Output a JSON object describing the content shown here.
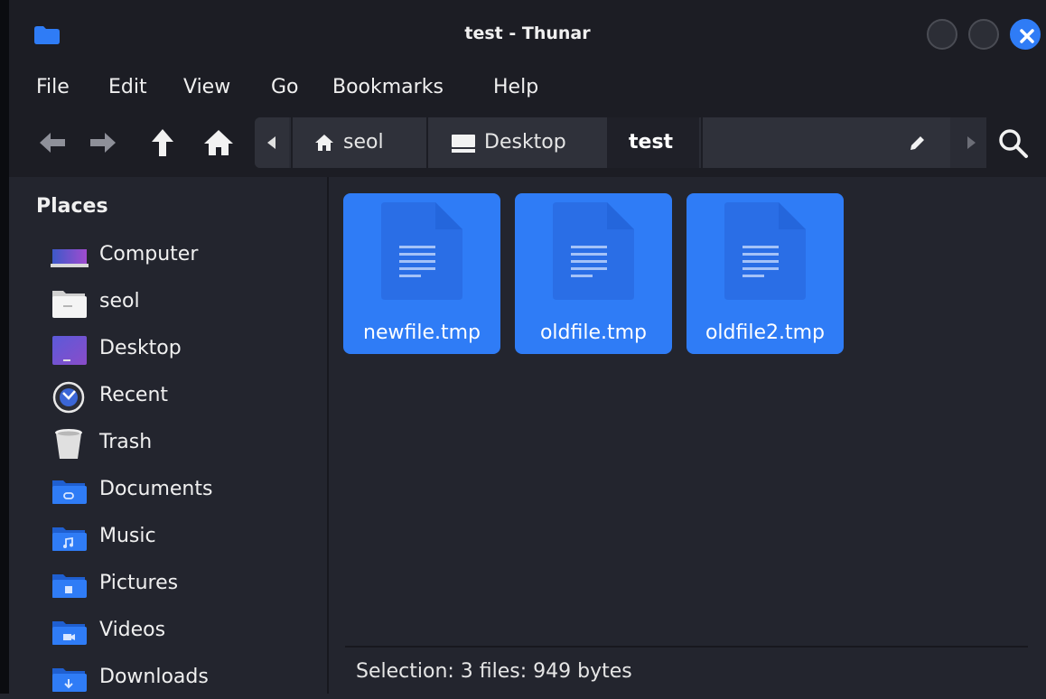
{
  "window": {
    "title": "test - Thunar"
  },
  "menu": [
    "File",
    "Edit",
    "View",
    "Go",
    "Bookmarks",
    "Help"
  ],
  "toolbar": {
    "buttons": [
      "back-arrow-icon",
      "forward-arrow-icon",
      "up-arrow-icon",
      "home-icon"
    ],
    "breadcrumbs": [
      "seol",
      "Desktop"
    ],
    "current_folder": "test",
    "path_edit_icon": "pencil-icon",
    "search_icon": "search-icon"
  },
  "sidebar": {
    "heading": "Places",
    "items": [
      {
        "label": "Computer",
        "icon": "computer-icon"
      },
      {
        "label": "seol",
        "icon": "home-folder-icon"
      },
      {
        "label": "Desktop",
        "icon": "desktop-icon"
      },
      {
        "label": "Recent",
        "icon": "recent-clock-icon"
      },
      {
        "label": "Trash",
        "icon": "trash-icon"
      },
      {
        "label": "Documents",
        "icon": "documents-folder-icon"
      },
      {
        "label": "Music",
        "icon": "music-folder-icon"
      },
      {
        "label": "Pictures",
        "icon": "pictures-folder-icon"
      },
      {
        "label": "Videos",
        "icon": "videos-folder-icon"
      },
      {
        "label": "Downloads",
        "icon": "downloads-folder-icon"
      }
    ]
  },
  "files": [
    {
      "name": "newfile.tmp",
      "selected": true
    },
    {
      "name": "oldfile.tmp",
      "selected": true
    },
    {
      "name": "oldfile2.tmp",
      "selected": true
    }
  ],
  "status": {
    "text": "Selection: 3 files: 949 bytes"
  },
  "colors": {
    "accent": "#2f7cf6",
    "background": "#23252e",
    "titlebar": "#1c1d24"
  }
}
